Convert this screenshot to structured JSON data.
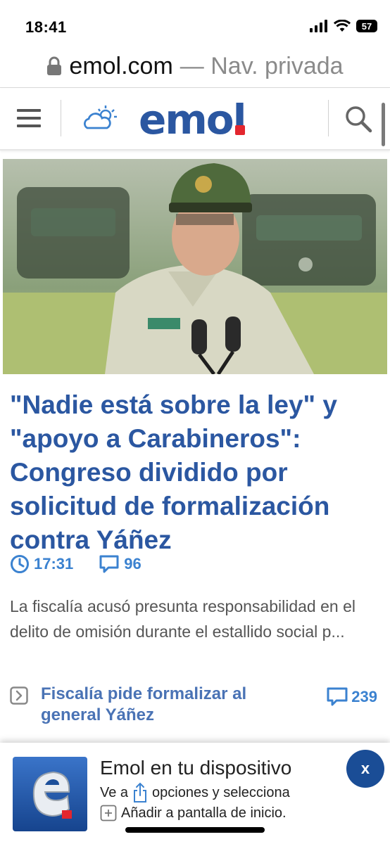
{
  "status_bar": {
    "time": "18:41",
    "battery": "57"
  },
  "browser": {
    "domain": "emol.com",
    "mode_label": "— Nav. privada"
  },
  "site": {
    "logo_text": "emol"
  },
  "article": {
    "headline": "\"Nadie está sobre la ley\" y \"apoyo a Carabineros\": Congreso dividido por solicitud de formalización contra Yáñez",
    "time": "17:31",
    "comments": "96",
    "summary": "La fiscalía acusó presunta responsabilidad en el delito de omisión durante el estallido social p..."
  },
  "related": {
    "title": "Fiscalía pide formalizar al general Yáñez",
    "comments": "239"
  },
  "install_banner": {
    "title": "Emol en tu dispositivo",
    "line1_prefix": "Ve a",
    "line1_suffix": "opciones y selecciona",
    "line2": "Añadir a pantalla de inicio.",
    "close_label": "x"
  },
  "colors": {
    "brand_blue": "#2b57a1",
    "link_blue": "#3b82d0",
    "logo_red": "#e3262e",
    "close_bg": "#1a4d96"
  },
  "icons": [
    "signal-icon",
    "wifi-icon",
    "battery-icon",
    "lock-icon",
    "hamburger-menu-icon",
    "weather-cloud-sun-icon",
    "search-icon",
    "clock-icon",
    "comment-icon",
    "chevron-right-icon",
    "share-icon",
    "add-square-icon",
    "close-icon"
  ]
}
